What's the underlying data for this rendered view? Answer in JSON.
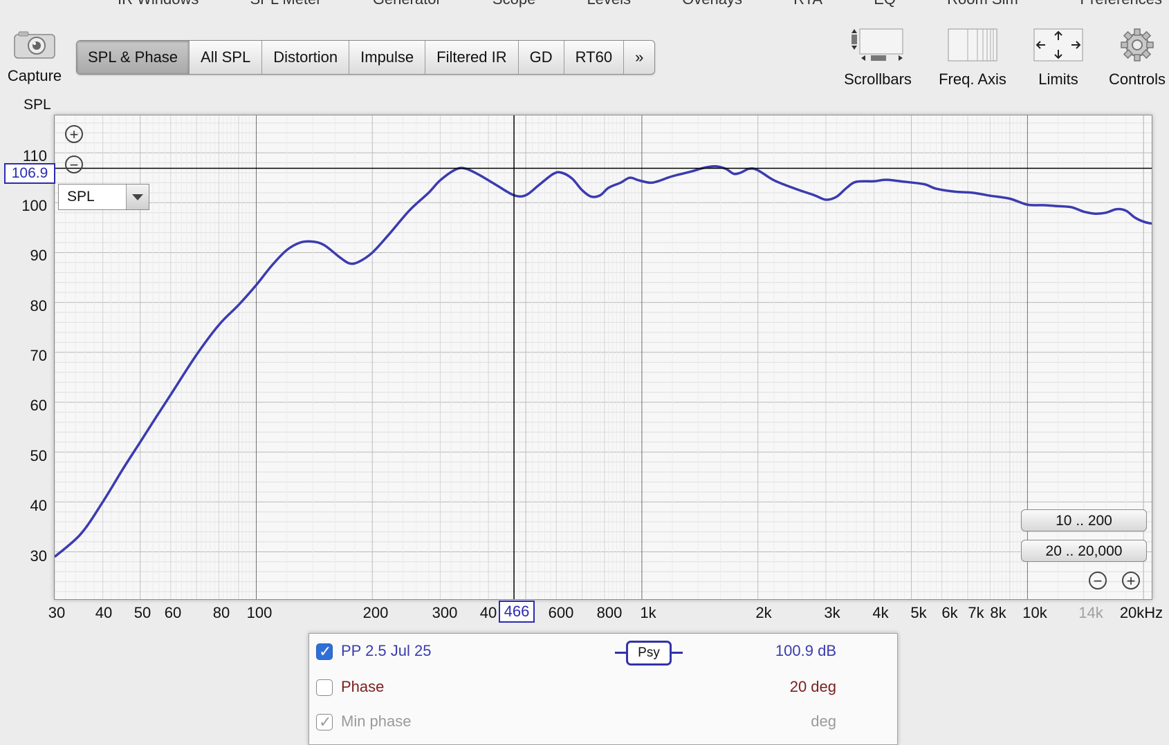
{
  "top_menu": [
    "IR Windows",
    "SPL Meter",
    "Generator",
    "Scope",
    "Levels",
    "Overlays",
    "RTA",
    "EQ",
    "Room Sim"
  ],
  "top_menu_right": "Preferences",
  "capture": {
    "label": "Capture",
    "icon": "camera-icon"
  },
  "tabs": [
    "SPL & Phase",
    "All SPL",
    "Distortion",
    "Impulse",
    "Filtered IR",
    "GD",
    "RT60",
    "»"
  ],
  "active_tab": "SPL & Phase",
  "toolbar": {
    "scrollbars": "Scrollbars",
    "freq_axis": "Freq. Axis",
    "limits": "Limits",
    "controls": "Controls"
  },
  "graph": {
    "y_axis_title": "SPL",
    "y_ticks": [
      110,
      100,
      90,
      80,
      70,
      60,
      50,
      40,
      30
    ],
    "x_ticks": [
      "30",
      "40",
      "50",
      "60",
      "80",
      "100",
      "200",
      "300",
      "40",
      "600",
      "800",
      "1k",
      "2k",
      "3k",
      "4k",
      "5k",
      "6k",
      "7k",
      "8k",
      "10k",
      "14k",
      "20kHz"
    ],
    "cursor_y_value": "106.9",
    "cursor_x_value": "466",
    "dropdown_value": "SPL",
    "range_buttons": [
      "10 .. 200",
      "20 .. 20,000"
    ],
    "trace_color": "#3b3bb0",
    "curve": [
      [
        30,
        29
      ],
      [
        35,
        33.5
      ],
      [
        40,
        40
      ],
      [
        45,
        46.5
      ],
      [
        50,
        52
      ],
      [
        55,
        57
      ],
      [
        60,
        61.5
      ],
      [
        70,
        69.5
      ],
      [
        80,
        75.5
      ],
      [
        90,
        79.5
      ],
      [
        100,
        83.5
      ],
      [
        110,
        87.5
      ],
      [
        120,
        90.5
      ],
      [
        130,
        92
      ],
      [
        140,
        92.2
      ],
      [
        150,
        91.5
      ],
      [
        165,
        89
      ],
      [
        175,
        87.8
      ],
      [
        185,
        88.2
      ],
      [
        200,
        90
      ],
      [
        220,
        93.5
      ],
      [
        250,
        98.5
      ],
      [
        280,
        102
      ],
      [
        300,
        104.5
      ],
      [
        330,
        106.7
      ],
      [
        350,
        106.8
      ],
      [
        380,
        105.5
      ],
      [
        420,
        103.5
      ],
      [
        466,
        101.5
      ],
      [
        500,
        101.5
      ],
      [
        540,
        103.5
      ],
      [
        590,
        105.8
      ],
      [
        620,
        106
      ],
      [
        660,
        104.8
      ],
      [
        700,
        102.5
      ],
      [
        740,
        101.2
      ],
      [
        780,
        101.5
      ],
      [
        820,
        103
      ],
      [
        880,
        104
      ],
      [
        930,
        105
      ],
      [
        980,
        104.5
      ],
      [
        1050,
        104
      ],
      [
        1100,
        104.3
      ],
      [
        1200,
        105.3
      ],
      [
        1350,
        106.3
      ],
      [
        1450,
        107
      ],
      [
        1550,
        107.3
      ],
      [
        1650,
        106.8
      ],
      [
        1730,
        105.8
      ],
      [
        1800,
        106
      ],
      [
        1900,
        106.8
      ],
      [
        2000,
        106.5
      ],
      [
        2200,
        104.5
      ],
      [
        2500,
        102.8
      ],
      [
        2800,
        101.5
      ],
      [
        3000,
        100.6
      ],
      [
        3200,
        101.2
      ],
      [
        3400,
        103
      ],
      [
        3600,
        104.2
      ],
      [
        4000,
        104.3
      ],
      [
        4300,
        104.6
      ],
      [
        4800,
        104.2
      ],
      [
        5400,
        103.7
      ],
      [
        5800,
        102.8
      ],
      [
        6500,
        102.2
      ],
      [
        7200,
        102
      ],
      [
        8000,
        101.4
      ],
      [
        9000,
        100.8
      ],
      [
        10000,
        99.6
      ],
      [
        11000,
        99.5
      ],
      [
        12000,
        99.3
      ],
      [
        13000,
        99.1
      ],
      [
        14000,
        98.2
      ],
      [
        15000,
        97.8
      ],
      [
        16000,
        98
      ],
      [
        17000,
        98.7
      ],
      [
        18000,
        98.4
      ],
      [
        19000,
        97
      ],
      [
        20000,
        96.2
      ],
      [
        21000,
        95.8
      ]
    ]
  },
  "legend": {
    "rows": [
      {
        "checked": true,
        "name": "PP 2.5 Jul 25",
        "value": "100.9 dB",
        "color": "#3b3bb0"
      },
      {
        "checked": false,
        "name": "Phase",
        "value": "20 deg",
        "color": "#7a2020"
      },
      {
        "checked": true,
        "name": "Min phase",
        "value": "deg",
        "color": "#9a9a9a"
      }
    ],
    "smoothing_badge": "Psy"
  }
}
